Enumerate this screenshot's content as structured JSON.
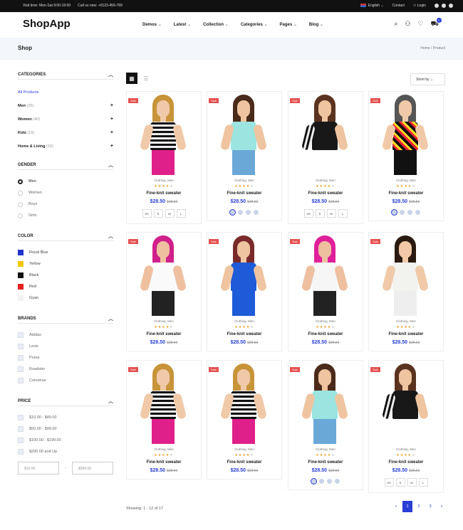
{
  "topbar": {
    "hours": "Visit time: Mon-Sat 9:00-19:00",
    "call": "Call us now: +0123-456-789",
    "language": "English",
    "contact": "Contact",
    "login": "Login"
  },
  "header": {
    "logo": "ShopApp",
    "nav": [
      "Demos",
      "Latest",
      "Collection",
      "Categories",
      "Pages",
      "Blog"
    ],
    "cart_count": "0"
  },
  "breadcrumb": {
    "title": "Shop",
    "path": "Home / Product"
  },
  "sidebar": {
    "categories_title": "CATEGORIES",
    "categories": [
      {
        "label": "All Products",
        "count": ""
      },
      {
        "label": "Men",
        "count": "(25)"
      },
      {
        "label": "Women",
        "count": "(40)"
      },
      {
        "label": "Kids",
        "count": "(15)"
      },
      {
        "label": "Home & Living",
        "count": "(18)"
      }
    ],
    "gender_title": "GENDER",
    "genders": [
      "Men",
      "Women",
      "Boys",
      "Girls"
    ],
    "color_title": "COLOR",
    "colors": [
      {
        "label": "Royal Blue",
        "hex": "#2233cc"
      },
      {
        "label": "Yellow",
        "hex": "#f2c500"
      },
      {
        "label": "Black",
        "hex": "#111111"
      },
      {
        "label": "Red",
        "hex": "#e52222"
      },
      {
        "label": "Gyan",
        "hex": "#f3f3f3"
      }
    ],
    "brands_title": "BRANDS",
    "brands": [
      "Adidas",
      "Levis",
      "Puma",
      "Roadster",
      "Converse"
    ],
    "price_title": "PRICE",
    "prices": [
      "$10.00 - $49.00",
      "$50.00 - $99.00",
      "$100.00 - $199.00",
      "$200.00 and Up"
    ],
    "price_min": "$10.00",
    "price_max": "$350.00"
  },
  "toolbar": {
    "sort_label": "Short by"
  },
  "products": [
    {
      "sale": "Sale",
      "category": "Clothing, Men",
      "name": "Fine-knit sweater",
      "price": "$28.50",
      "old_price": "$38.50",
      "rating": 4,
      "variant": "sizes",
      "figure": "stripe"
    },
    {
      "sale": "Sale",
      "category": "Clothing, Men",
      "name": "Fine-knit sweater",
      "price": "$28.50",
      "old_price": "$38.50",
      "rating": 4,
      "variant": "dots",
      "figure": "mint"
    },
    {
      "sale": "Sale",
      "category": "Clothing, Men",
      "name": "Fine-knit sweater",
      "price": "$28.50",
      "old_price": "$38.50",
      "rating": 4,
      "variant": "sizes",
      "figure": "black"
    },
    {
      "sale": "Sale",
      "category": "Clothing, Men",
      "name": "Fine-knit sweater",
      "price": "$28.50",
      "old_price": "$38.50",
      "rating": 4,
      "variant": "dots",
      "figure": "print"
    },
    {
      "sale": "Sale",
      "category": "Clothing, Men",
      "name": "Fine-knit sweater",
      "price": "$28.50",
      "old_price": "$38.50",
      "rating": 4,
      "variant": "none",
      "figure": "white"
    },
    {
      "sale": "Sale",
      "category": "Clothing, Men",
      "name": "Fine-knit sweater",
      "price": "$28.50",
      "old_price": "$38.50",
      "rating": 4,
      "variant": "none",
      "figure": "blue"
    },
    {
      "sale": "Sale",
      "category": "Clothing, Men",
      "name": "Fine-knit sweater",
      "price": "$28.50",
      "old_price": "$38.50",
      "rating": 4,
      "variant": "none",
      "figure": "pinkcap"
    },
    {
      "sale": "Sale",
      "category": "Clothing, Men",
      "name": "Fine-knit sweater",
      "price": "$28.50",
      "old_price": "$38.50",
      "rating": 4,
      "variant": "none",
      "figure": "cup"
    },
    {
      "sale": "Sale",
      "category": "Clothing, Men",
      "name": "Fine-knit sweater",
      "price": "$28.50",
      "old_price": "$38.50",
      "rating": 4,
      "variant": "none",
      "figure": "stripe"
    },
    {
      "sale": "Sale",
      "category": "Clothing, Men",
      "name": "Fine-knit sweater",
      "price": "$28.50",
      "old_price": "$38.50",
      "rating": 4,
      "variant": "none",
      "figure": "stripe"
    },
    {
      "sale": "Sale",
      "category": "Clothing, Men",
      "name": "Fine-knit sweater",
      "price": "$28.50",
      "old_price": "$38.50",
      "rating": 4,
      "variant": "dots",
      "figure": "mint"
    },
    {
      "sale": "Sale",
      "category": "Clothing, Men",
      "name": "Fine-knit sweater",
      "price": "$28.50",
      "old_price": "$38.50",
      "rating": 4,
      "variant": "sizes",
      "figure": "black"
    }
  ],
  "sizes": [
    "XS",
    "S",
    "M",
    "L"
  ],
  "footer": {
    "showing": "Showing: 1 - 12 of 17",
    "pages": [
      "«",
      "1",
      "2",
      "3",
      "»"
    ]
  }
}
